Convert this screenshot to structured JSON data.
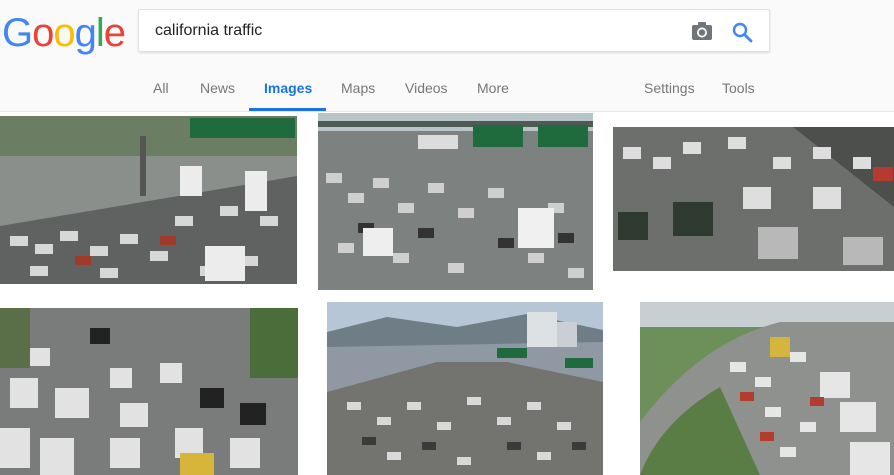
{
  "logo": {
    "letters": [
      "G",
      "o",
      "o",
      "g",
      "l",
      "e"
    ],
    "colors": [
      "#4285F4",
      "#EA4335",
      "#FBBC05",
      "#4285F4",
      "#34A853",
      "#EA4335"
    ]
  },
  "search": {
    "query": "california traffic",
    "camera_icon": "camera-icon",
    "search_icon": "search-icon"
  },
  "tabs": {
    "all": "All",
    "news": "News",
    "images": "Images",
    "maps": "Maps",
    "videos": "Videos",
    "more": "More",
    "settings": "Settings",
    "tools": "Tools"
  },
  "active_tab": "Images",
  "accent_color": "#1a73e8",
  "results": {
    "count": 6,
    "subject": "california traffic images"
  }
}
